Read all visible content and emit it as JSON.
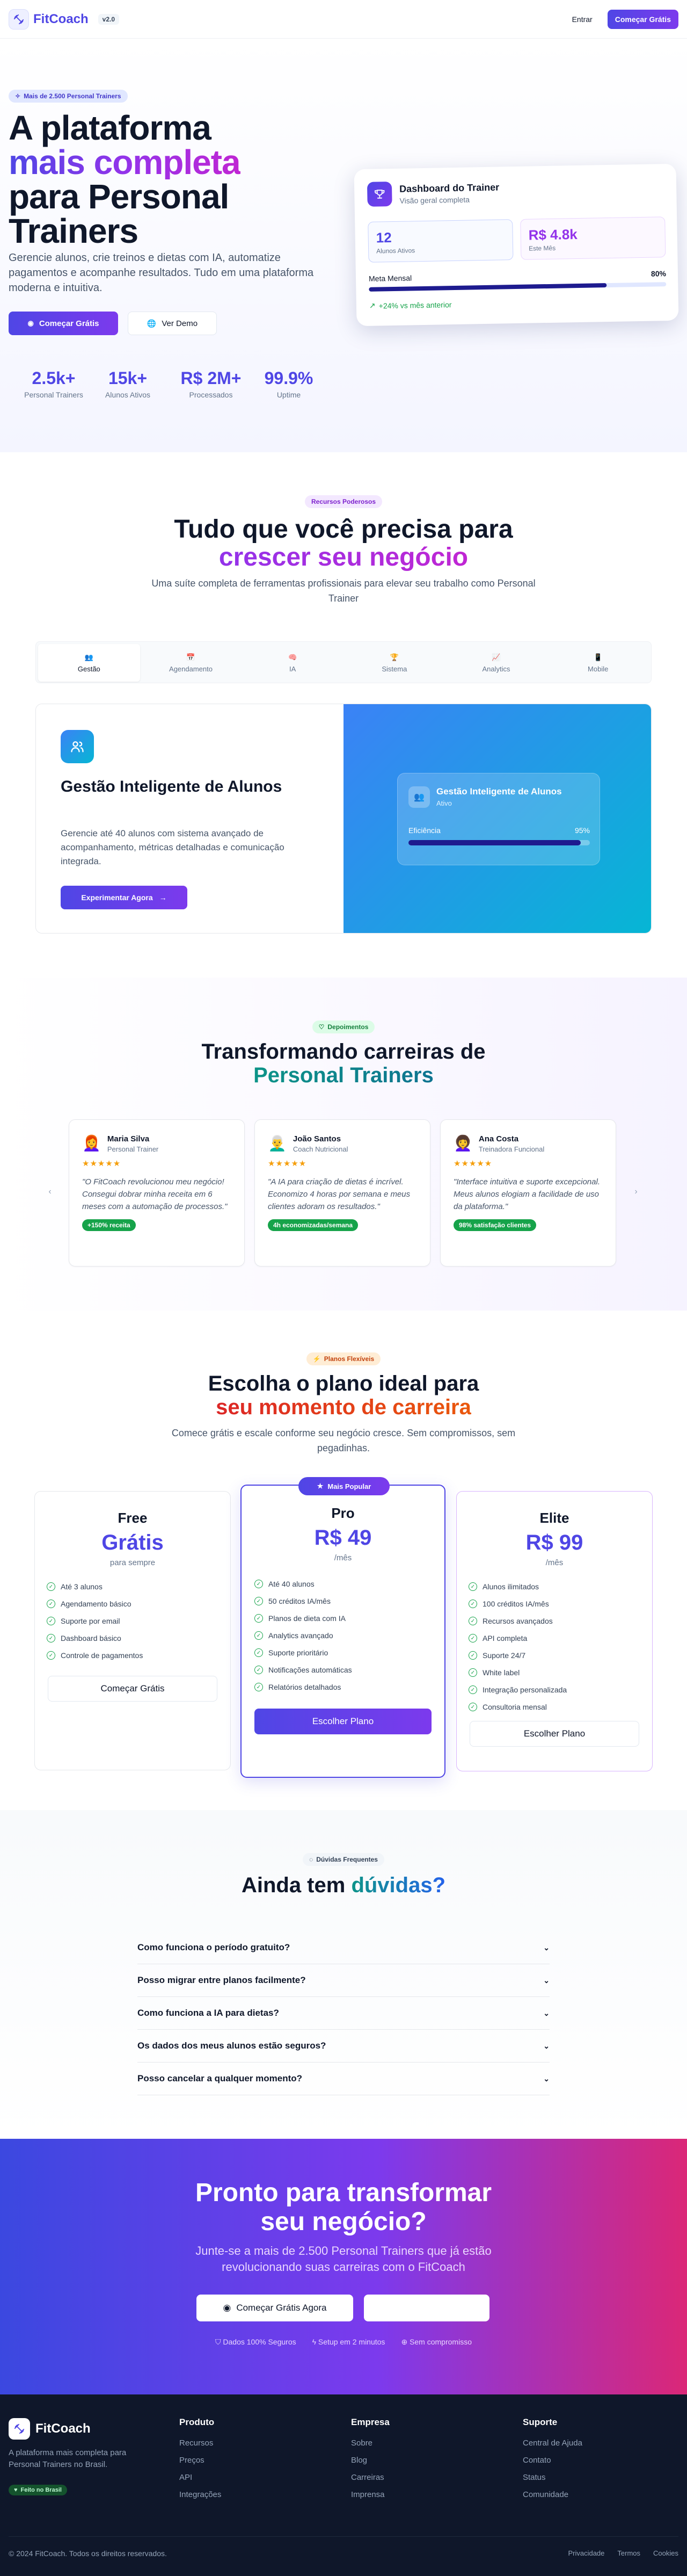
{
  "nav": {
    "logo": "FitCoach",
    "version": "v2.0",
    "login": "Entrar",
    "cta": "Começar Grátis"
  },
  "hero": {
    "badge": "Mais de 2.500 Personal Trainers",
    "title_line1": "A plataforma",
    "title_line2": "mais completa",
    "title_line3": "para Personal",
    "title_line4": "Trainers",
    "subtitle": "Gerencie alunos, crie treinos e dietas com IA, automatize pagamentos e acompanhe resultados. Tudo em uma plataforma moderna e intuitiva.",
    "primary_btn": "Começar Grátis",
    "secondary_btn": "Ver Demo",
    "stats": [
      {
        "value": "2.5k+",
        "label": "Personal Trainers"
      },
      {
        "value": "15k+",
        "label": "Alunos Ativos"
      },
      {
        "value": "R$ 2M+",
        "label": "Processados"
      },
      {
        "value": "99.9%",
        "label": "Uptime"
      }
    ],
    "dashboard": {
      "title": "Dashboard do Trainer",
      "subtitle": "Visão geral completa",
      "metric1_value": "12",
      "metric1_label": "Alunos Ativos",
      "metric2_value": "R$ 4.8k",
      "metric2_label": "Este Mês",
      "goal_label": "Meta Mensal",
      "goal_value": "80%",
      "goal_progress": 0.8,
      "trend": "+24% vs mês anterior"
    }
  },
  "features": {
    "badge": "Recursos Poderosos",
    "title_line1": "Tudo que você precisa para",
    "title_line2": "crescer seu negócio",
    "subtitle": "Uma suíte completa de ferramentas profissionais para elevar seu trabalho como Personal Trainer",
    "tabs": [
      "Gestão",
      "Agendamento",
      "IA",
      "Sistema",
      "Analytics",
      "Mobile"
    ],
    "active_tab": "Gestão",
    "panel": {
      "title": "Gestão Inteligente de Alunos",
      "description": "Gerencie até 40 alunos com sistema avançado de acompanhamento, métricas detalhadas e comunicação integrada.",
      "button": "Experimentar Agora",
      "preview_title": "Gestão Inteligente de Alunos",
      "preview_status": "Ativo",
      "preview_metric": "Eficiência",
      "preview_value": "95%",
      "preview_progress": 0.95
    }
  },
  "testimonials": {
    "badge": "Depoimentos",
    "title_line1": "Transformando carreiras de",
    "title_line2": "Personal Trainers",
    "items": [
      {
        "avatar": "👩‍🦰",
        "name": "Maria Silva",
        "role": "Personal Trainer",
        "stars": "★★★★★",
        "quote": "\"O FitCoach revolucionou meu negócio! Consegui dobrar minha receita em 6 meses com a automação de processos.\"",
        "badge": "+150% receita"
      },
      {
        "avatar": "👨‍🦳",
        "name": "João Santos",
        "role": "Coach Nutricional",
        "stars": "★★★★★",
        "quote": "\"A IA para criação de dietas é incrível. Economizo 4 horas por semana e meus clientes adoram os resultados.\"",
        "badge": "4h economizadas/semana"
      },
      {
        "avatar": "👩‍🦱",
        "name": "Ana Costa",
        "role": "Treinadora Funcional",
        "stars": "★★★★★",
        "quote": "\"Interface intuitiva e suporte excepcional. Meus alunos elogiam a facilidade de uso da plataforma.\"",
        "badge": "98% satisfação clientes"
      }
    ]
  },
  "pricing": {
    "badge": "Planos Flexíveis",
    "title_line1": "Escolha o plano ideal para",
    "title_line2": "seu momento de carreira",
    "subtitle": "Comece grátis e escale conforme seu negócio cresce. Sem compromissos, sem pegadinhas.",
    "plans": [
      {
        "name": "Free",
        "price": "Grátis",
        "period": "para sempre",
        "features": [
          "Até 3 alunos",
          "Agendamento básico",
          "Suporte por email",
          "Dashboard básico",
          "Controle de pagamentos"
        ],
        "button": "Começar Grátis"
      },
      {
        "name": "Pro",
        "price": "R$ 49",
        "period": "/mês",
        "ribbon": "Mais Popular",
        "features": [
          "Até 40 alunos",
          "50 créditos IA/mês",
          "Planos de dieta com IA",
          "Analytics avançado",
          "Suporte prioritário",
          "Notificações automáticas",
          "Relatórios detalhados"
        ],
        "button": "Escolher Plano"
      },
      {
        "name": "Elite",
        "price": "R$ 99",
        "period": "/mês",
        "features": [
          "Alunos ilimitados",
          "100 créditos IA/mês",
          "Recursos avançados",
          "API completa",
          "Suporte 24/7",
          "White label",
          "Integração personalizada",
          "Consultoria mensal"
        ],
        "button": "Escolher Plano"
      }
    ]
  },
  "faq": {
    "badge": "Dúvidas Frequentes",
    "title_a": "Ainda tem",
    "title_b": "dúvidas?",
    "items": [
      "Como funciona o período gratuito?",
      "Posso migrar entre planos facilmente?",
      "Como funciona a IA para dietas?",
      "Os dados dos meus alunos estão seguros?",
      "Posso cancelar a qualquer momento?"
    ]
  },
  "cta": {
    "title_line1": "Pronto para transformar",
    "title_line2": "seu negócio?",
    "subtitle": "Junte-se a mais de 2.500 Personal Trainers que já estão revolucionando suas carreiras com o FitCoach",
    "primary_btn": "Começar Grátis Agora",
    "secondary_btn": "",
    "trust": [
      "Dados 100% Seguros",
      "Setup em 2 minutos",
      "Sem compromisso"
    ]
  },
  "footer": {
    "brand": "FitCoach",
    "tagline": "A plataforma mais completa para Personal Trainers no Brasil.",
    "made_in": "Feito no Brasil",
    "columns": [
      {
        "title": "Produto",
        "links": [
          "Recursos",
          "Preços",
          "API",
          "Integrações"
        ]
      },
      {
        "title": "Empresa",
        "links": [
          "Sobre",
          "Blog",
          "Carreiras",
          "Imprensa"
        ]
      },
      {
        "title": "Suporte",
        "links": [
          "Central de Ajuda",
          "Contato",
          "Status",
          "Comunidade"
        ]
      }
    ],
    "copyright": "© 2024 FitCoach. Todos os direitos reservados.",
    "legal": [
      "Privacidade",
      "Termos",
      "Cookies"
    ]
  },
  "colors": {
    "primary": "#4f46e5",
    "accent": "#9333ea",
    "success": "#16a34a",
    "cta_start": "#3b48e0",
    "cta_end": "#db2777",
    "footer_bg": "#0f172a"
  }
}
